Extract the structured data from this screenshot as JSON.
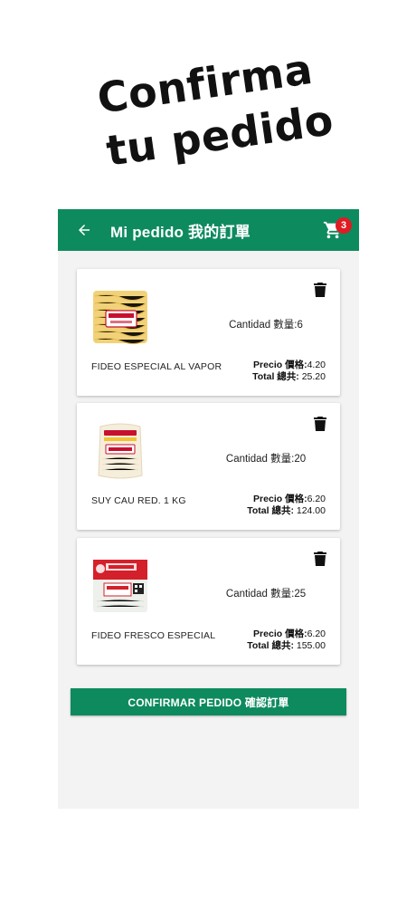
{
  "promo": {
    "line1": "Confirma",
    "line2": "tu pedido"
  },
  "appbar": {
    "title": "Mi pedido 我的訂單",
    "back_icon": "arrow-left-icon",
    "cart_icon": "shopping-cart-icon",
    "cart_count": "3",
    "color": "#0e8a5f"
  },
  "items": [
    {
      "name": "FIDEO ESPECIAL AL VAPOR",
      "quantity_label": "Cantidad 數量:6",
      "price_label": "Precio 價格:",
      "price_value": "4.20",
      "total_label": "Total 總共:",
      "total_value": " 25.20"
    },
    {
      "name": "SUY CAU RED. 1 KG",
      "quantity_label": "Cantidad 數量:20",
      "price_label": "Precio 價格:",
      "price_value": "6.20",
      "total_label": "Total 總共:",
      "total_value": " 124.00"
    },
    {
      "name": "FIDEO FRESCO ESPECIAL",
      "quantity_label": "Cantidad 數量:25",
      "price_label": "Precio 價格:",
      "price_value": "6.20",
      "total_label": "Total 總共:",
      "total_value": " 155.00"
    }
  ],
  "confirm_button": "CONFIRMAR PEDIDO 確認訂單",
  "colors": {
    "brand_green": "#0e8a5f",
    "badge_red": "#e01b24",
    "background": "#f3f3f3"
  }
}
